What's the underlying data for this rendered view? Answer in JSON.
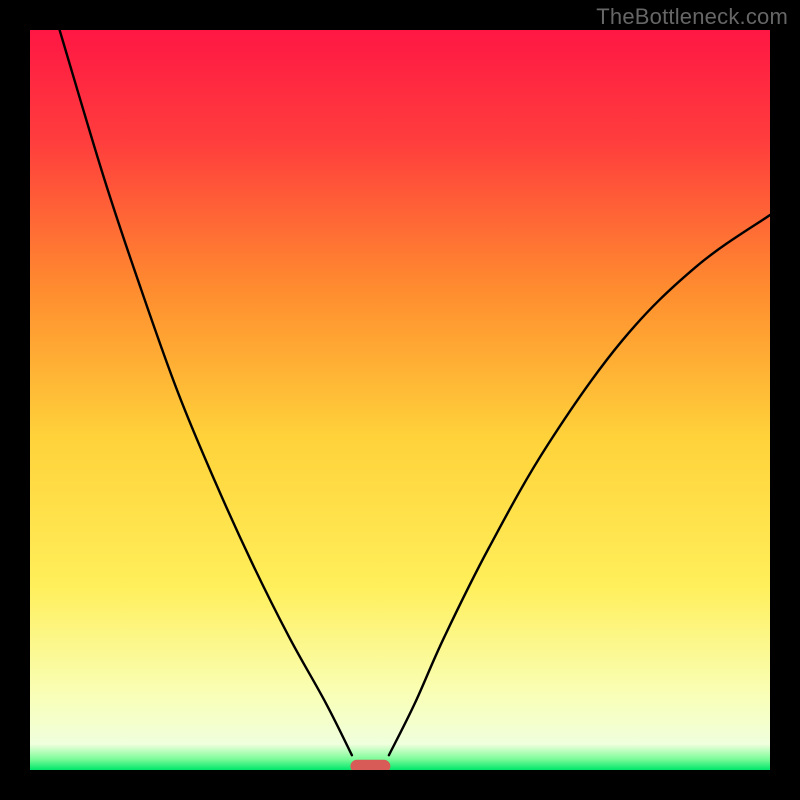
{
  "watermark": "TheBottleneck.com",
  "chart_data": {
    "type": "line",
    "title": "",
    "xlabel": "",
    "ylabel": "",
    "xlim": [
      0,
      100
    ],
    "ylim": [
      0,
      100
    ],
    "background_gradient_stops": [
      {
        "offset": 0,
        "color": "#ff1744"
      },
      {
        "offset": 0.15,
        "color": "#ff3d3d"
      },
      {
        "offset": 0.35,
        "color": "#ff8c2f"
      },
      {
        "offset": 0.55,
        "color": "#ffd23a"
      },
      {
        "offset": 0.75,
        "color": "#ffef5a"
      },
      {
        "offset": 0.9,
        "color": "#f9ffb8"
      },
      {
        "offset": 0.965,
        "color": "#f0ffdd"
      },
      {
        "offset": 0.985,
        "color": "#7efc9a"
      },
      {
        "offset": 1.0,
        "color": "#00e66b"
      }
    ],
    "series": [
      {
        "name": "left_cusp",
        "x": [
          4,
          10,
          15,
          20,
          25,
          30,
          35,
          40,
          43.5
        ],
        "y": [
          100,
          80,
          65,
          51,
          39,
          28,
          18,
          9,
          2
        ]
      },
      {
        "name": "right_cusp",
        "x": [
          48.5,
          52,
          56,
          62,
          70,
          80,
          90,
          100
        ],
        "y": [
          2,
          9,
          18,
          30,
          44,
          58,
          68,
          75
        ]
      }
    ],
    "marker": {
      "x_center": 46,
      "width": 5.4,
      "y": 0.5,
      "color": "#d95b57"
    }
  }
}
